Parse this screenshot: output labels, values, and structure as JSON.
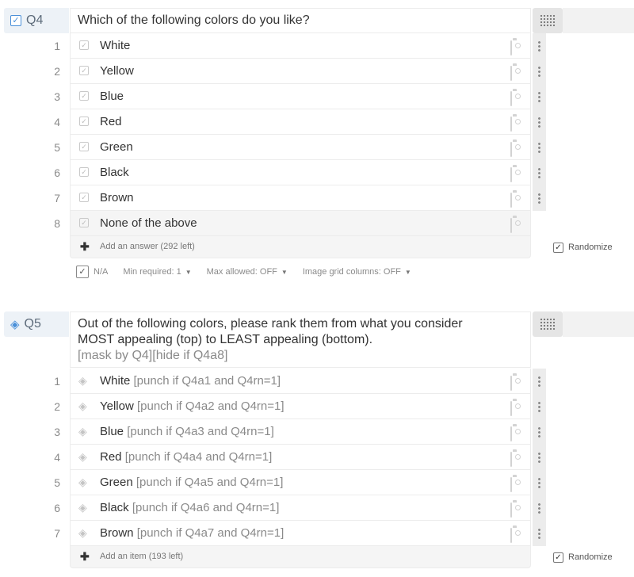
{
  "q4": {
    "number": "Q4",
    "text": "Which of the following colors do you like?",
    "answers": [
      {
        "num": "1",
        "label": "White"
      },
      {
        "num": "2",
        "label": "Yellow"
      },
      {
        "num": "3",
        "label": "Blue"
      },
      {
        "num": "4",
        "label": "Red"
      },
      {
        "num": "5",
        "label": "Green"
      },
      {
        "num": "6",
        "label": "Black"
      },
      {
        "num": "7",
        "label": "Brown"
      },
      {
        "num": "8",
        "label": "None of the above"
      }
    ],
    "add_label": "Add an answer (292 left)",
    "randomize_label": "Randomize",
    "options": {
      "na_label": "N/A",
      "min_required": "Min required: 1",
      "max_allowed": "Max allowed: OFF",
      "grid_columns": "Image grid columns: OFF"
    }
  },
  "q5": {
    "number": "Q5",
    "text": "Out of the following colors, please rank them from what you consider MOST appealing (top) to LEAST appealing (bottom).",
    "logic": "[mask by Q4][hide if Q4a8]",
    "items": [
      {
        "num": "1",
        "label": "White",
        "logic": "[punch if Q4a1 and Q4rn=1]"
      },
      {
        "num": "2",
        "label": "Yellow",
        "logic": "[punch if Q4a2 and Q4rn=1]"
      },
      {
        "num": "3",
        "label": "Blue",
        "logic": "[punch if Q4a3 and Q4rn=1]"
      },
      {
        "num": "4",
        "label": "Red",
        "logic": "[punch if Q4a4 and Q4rn=1]"
      },
      {
        "num": "5",
        "label": "Green",
        "logic": "[punch if Q4a5  and Q4rn=1]"
      },
      {
        "num": "6",
        "label": "Black",
        "logic": "[punch if Q4a6 and Q4rn=1]"
      },
      {
        "num": "7",
        "label": "Brown",
        "logic": "[punch if Q4a7 and Q4rn=1]"
      }
    ],
    "add_label": "Add an item (193 left)",
    "randomize_label": "Randomize"
  },
  "icons": {
    "question_type_q4": "checkbox-icon",
    "question_type_q5": "ranking-icon",
    "image": "camera-icon",
    "grid": "grid-icon",
    "menu": "kebab-icon",
    "add": "plus-icon"
  },
  "colors": {
    "accent": "#4a90d9",
    "header_bg": "#edf2f7",
    "border": "#ececec",
    "muted_text": "#8a8a8a"
  }
}
